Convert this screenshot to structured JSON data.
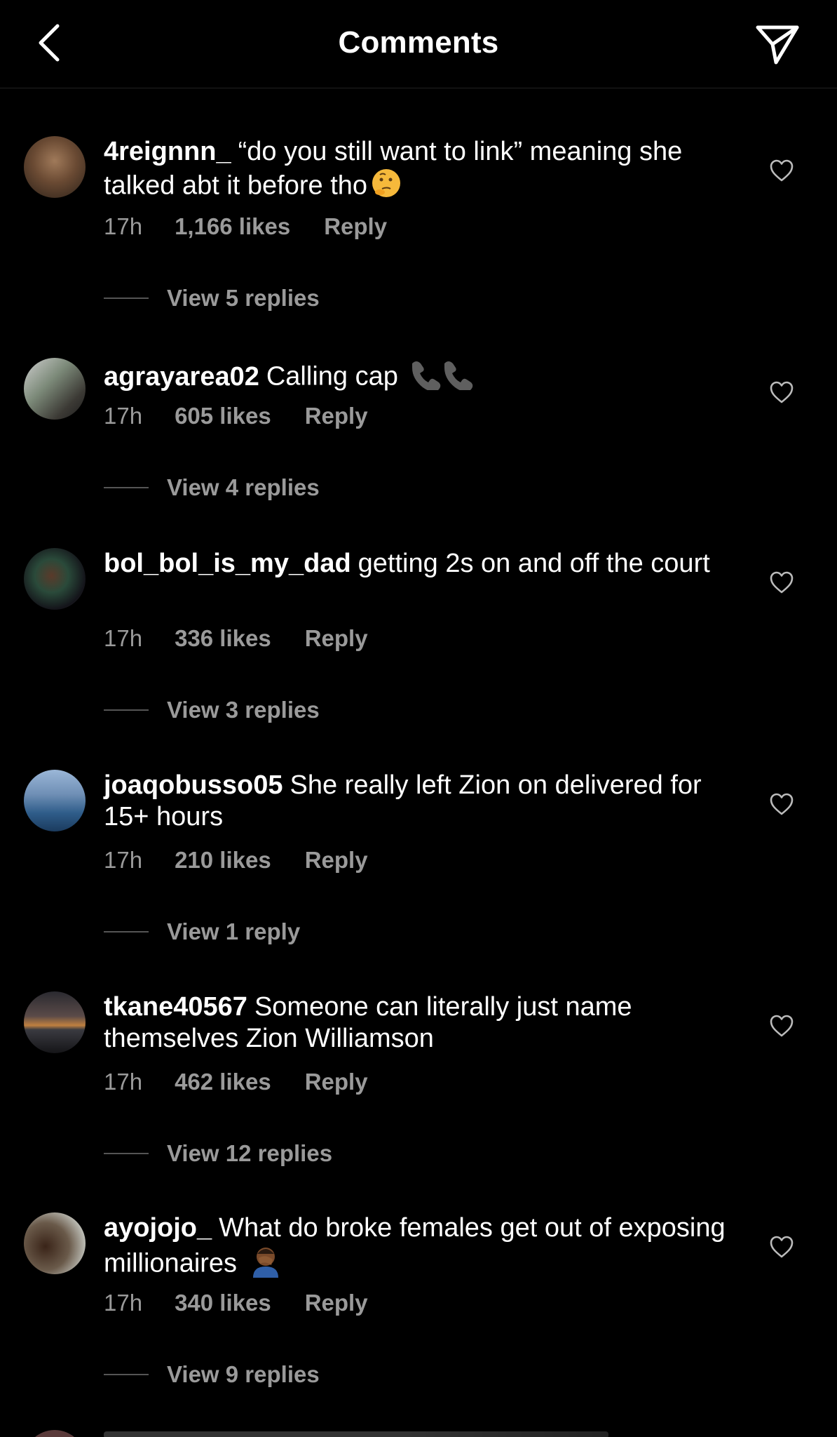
{
  "header": {
    "title": "Comments",
    "back_icon": "chevron-left-icon",
    "send_icon": "paper-plane-icon"
  },
  "colors": {
    "background": "#000000",
    "text": "#ffffff",
    "muted": "#9a9a9a"
  },
  "comments": [
    {
      "username": "4reignnn_",
      "text": "“do you still want to link” meaning she talked abt it before tho",
      "emoji": "thinking-face-icon",
      "time": "17h",
      "likes": "1,166 likes",
      "reply": "Reply",
      "view_replies": "View 5 replies"
    },
    {
      "username": "agrayarea02",
      "text": "Calling cap",
      "emoji": "telephone-receiver-icon",
      "time": "17h",
      "likes": "605 likes",
      "reply": "Reply",
      "view_replies": "View 4 replies"
    },
    {
      "username": "bol_bol_is_my_dad",
      "text": "getting 2s on and off the court",
      "time": "17h",
      "likes": "336 likes",
      "reply": "Reply",
      "view_replies": "View 3 replies"
    },
    {
      "username": "joaqobusso05",
      "text": "She really left Zion on delivered for 15+ hours",
      "time": "17h",
      "likes": "210 likes",
      "reply": "Reply",
      "view_replies": "View 1 reply"
    },
    {
      "username": "tkane40567",
      "text": "Someone can literally just name themselves Zion Williamson",
      "time": "17h",
      "likes": "462 likes",
      "reply": "Reply",
      "view_replies": "View 12 replies"
    },
    {
      "username": "ayojojo_",
      "text": "What do broke females get out of exposing millionaires",
      "emoji": "person-facepalming-icon",
      "time": "17h",
      "likes": "340 likes",
      "reply": "Reply",
      "view_replies": "View 9 replies"
    }
  ]
}
